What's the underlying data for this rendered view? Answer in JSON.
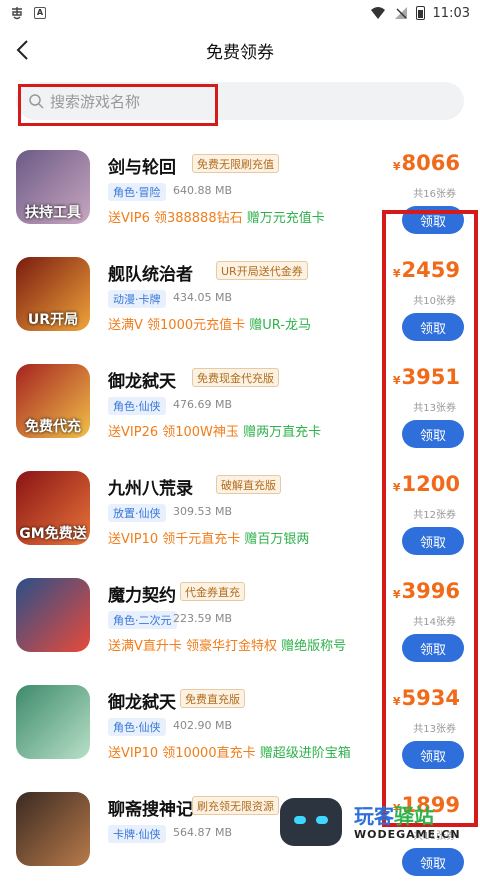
{
  "status": {
    "time": "11:03"
  },
  "header": {
    "title": "免费领券"
  },
  "search": {
    "placeholder": "搜索游戏名称"
  },
  "games": [
    {
      "name": "剑与轮回",
      "tag": "免费无限刷充值",
      "category": "角色·冒险",
      "size": "640.88 MB",
      "perk_orange": "送VIP6 领388888钻石",
      "perk_green": "赠万元充值卡",
      "price": "8066",
      "currency": "¥",
      "count": "共16张券",
      "button": "领取",
      "icon_overlay": "扶持工具",
      "icon_colors": [
        "#6b5a86",
        "#c9a7c0"
      ]
    },
    {
      "name": "舰队统治者",
      "tag": "UR开局送代金券",
      "category": "动漫·卡牌",
      "size": "434.05 MB",
      "perk_orange": "送满V 领1000元充值卡",
      "perk_green": "赠UR-龙马",
      "price": "2459",
      "currency": "¥",
      "count": "共10张券",
      "button": "领取",
      "icon_overlay": "UR开局",
      "icon_colors": [
        "#7a1b10",
        "#f0a43a"
      ]
    },
    {
      "name": "御龙弑天",
      "tag": "免费现金代充版",
      "category": "角色·仙侠",
      "size": "476.69 MB",
      "perk_orange": "送VIP26 领100W神玉",
      "perk_green": "赠两万直充卡",
      "price": "3951",
      "currency": "¥",
      "count": "共13张券",
      "button": "领取",
      "icon_overlay": "免费代充",
      "icon_colors": [
        "#a42320",
        "#f2c04a"
      ]
    },
    {
      "name": "九州八荒录",
      "tag": "破解直充版",
      "category": "放置·仙侠",
      "size": "309.53 MB",
      "perk_orange": "送VIP10 领千元直充卡",
      "perk_green": "赠百万银两",
      "price": "1200",
      "currency": "¥",
      "count": "共12张券",
      "button": "领取",
      "icon_overlay": "GM免费送",
      "icon_colors": [
        "#8a1414",
        "#e8743a"
      ]
    },
    {
      "name": "魔力契约",
      "tag": "代金券直充",
      "category": "角色·二次元",
      "size": "223.59 MB",
      "perk_orange": "送满V直升卡 领豪华打金特权",
      "perk_green": "赠绝版称号",
      "price": "3996",
      "currency": "¥",
      "count": "共14张券",
      "button": "领取",
      "icon_overlay": "",
      "icon_colors": [
        "#2a4f8a",
        "#e84a3a"
      ]
    },
    {
      "name": "御龙弑天",
      "tag": "免费直充版",
      "category": "角色·仙侠",
      "size": "402.90 MB",
      "perk_orange": "送VIP10 领10000直充卡",
      "perk_green": "赠超级进阶宝箱",
      "price": "5934",
      "currency": "¥",
      "count": "共13张券",
      "button": "领取",
      "icon_overlay": "",
      "icon_colors": [
        "#3d8a6a",
        "#b8e0c8"
      ]
    },
    {
      "name": "聊斋搜神记",
      "tag": "刷充领无限资源",
      "category": "卡牌·仙侠",
      "size": "564.87 MB",
      "perk_orange": "",
      "perk_green": "",
      "price": "1899",
      "currency": "¥",
      "count": "共11张券",
      "button": "领取",
      "icon_overlay": "",
      "icon_colors": [
        "#3a2a22",
        "#b87a4a"
      ]
    }
  ],
  "watermark": {
    "brand_blue": "玩客",
    "brand_green": "驿站",
    "domain": "WODEGAME.CN"
  }
}
